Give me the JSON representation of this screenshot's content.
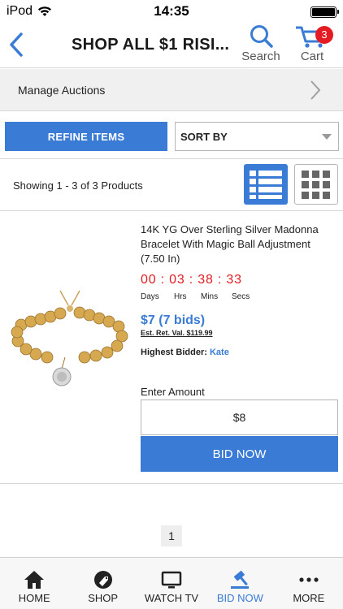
{
  "status_bar": {
    "carrier": "iPod",
    "time": "14:35"
  },
  "nav": {
    "title": "SHOP ALL $1 RISI...",
    "search_label": "Search",
    "cart_label": "Cart",
    "cart_count": "3"
  },
  "manage": {
    "label": "Manage Auctions"
  },
  "filters": {
    "refine_label": "REFINE ITEMS",
    "sort_label": "SORT BY"
  },
  "results": {
    "showing_text": "Showing 1 - 3 of 3 Products"
  },
  "product": {
    "title": "14K YG Over Sterling Silver Madonna Bracelet With Magic Ball Adjustment (7.50 In)",
    "timer": "00 : 03 : 38 : 33",
    "timer_units": [
      "Days",
      "Hrs",
      "Mins",
      "Secs"
    ],
    "price": "$7 (7 bids)",
    "retail": "Est. Ret. Val. $119.99",
    "highest_bidder_label": "Highest Bidder:",
    "highest_bidder_name": "Kate",
    "enter_amount_label": "Enter Amount",
    "amount_value": "$8",
    "bid_button": "BID NOW"
  },
  "pagination": {
    "current_page": "1"
  },
  "tabbar": {
    "items": [
      {
        "label": "HOME",
        "icon": "home-icon"
      },
      {
        "label": "SHOP",
        "icon": "tag-icon"
      },
      {
        "label": "WATCH TV",
        "icon": "tv-icon"
      },
      {
        "label": "BID NOW",
        "icon": "gavel-icon",
        "active": true
      },
      {
        "label": "MORE",
        "icon": "more-icon"
      }
    ]
  },
  "colors": {
    "accent": "#3a7bd5",
    "timer": "#e41b23",
    "badge": "#e41b23"
  }
}
